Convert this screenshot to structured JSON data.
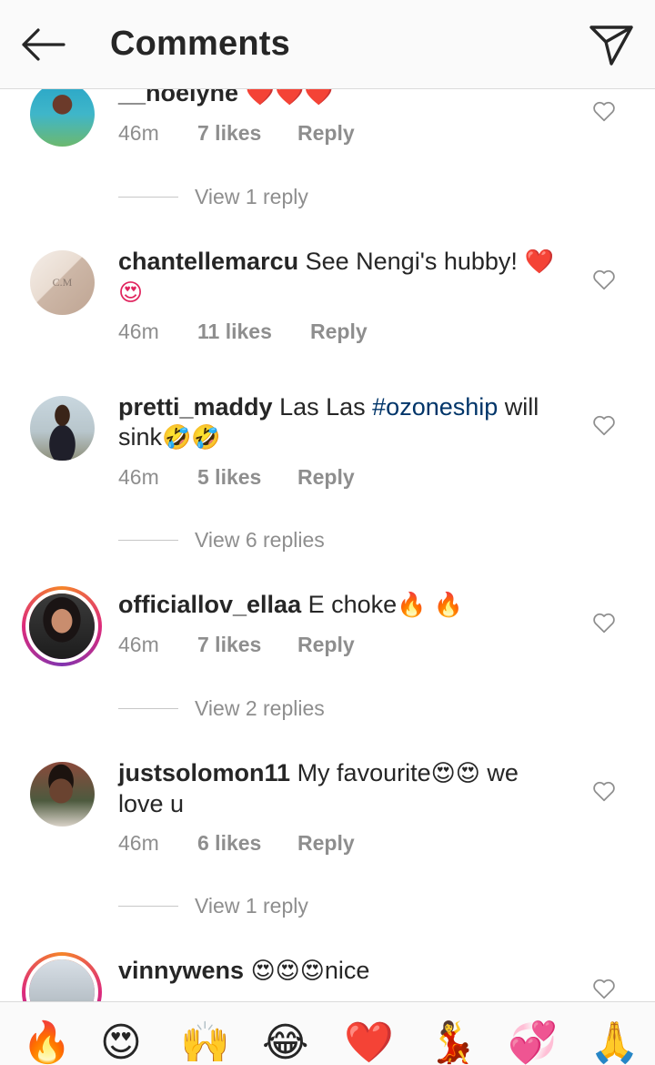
{
  "header": {
    "title": "Comments",
    "back_icon": "arrow-left-icon",
    "send_icon": "paper-plane-icon"
  },
  "comments": [
    {
      "username": "__noelyne",
      "text": "",
      "emojis": "❤️❤️❤️",
      "time": "46m",
      "likes": "7 likes",
      "reply": "Reply",
      "view_replies": "View 1 reply"
    },
    {
      "username": "chantellemarcu",
      "text": "See Nengi's hubby!",
      "emojis": "❤️ 😍",
      "time": "46m",
      "likes": "11 likes",
      "reply": "Reply",
      "avatar_text": "C.M"
    },
    {
      "username": "pretti_maddy",
      "text_before": "Las Las",
      "hashtag": "#ozoneship",
      "text_after": "will sink",
      "emojis": "🤣🤣",
      "time": "46m",
      "likes": "5 likes",
      "reply": "Reply",
      "view_replies": "View 6 replies"
    },
    {
      "username": "officiallov_ellaa",
      "text": "E choke",
      "emojis": "🔥 🔥",
      "time": "46m",
      "likes": "7 likes",
      "reply": "Reply",
      "view_replies": "View 2 replies"
    },
    {
      "username": "justsolomon11",
      "text_before": "My favourite",
      "emojis": "😍😍",
      "text_after": "we love u",
      "time": "46m",
      "likes": "6 likes",
      "reply": "Reply",
      "view_replies": "View 1 reply"
    },
    {
      "username": "vinnywens",
      "emojis": "😍😍😍",
      "text": "nice"
    }
  ],
  "emoji_bar": [
    "🔥",
    "😍",
    "🙌",
    "😂",
    "❤️",
    "💃",
    "💞",
    "🙏"
  ],
  "colors": {
    "text": "#262626",
    "secondary": "#8e8e8e",
    "hashtag": "#003569",
    "header_bg": "#fafafa"
  }
}
